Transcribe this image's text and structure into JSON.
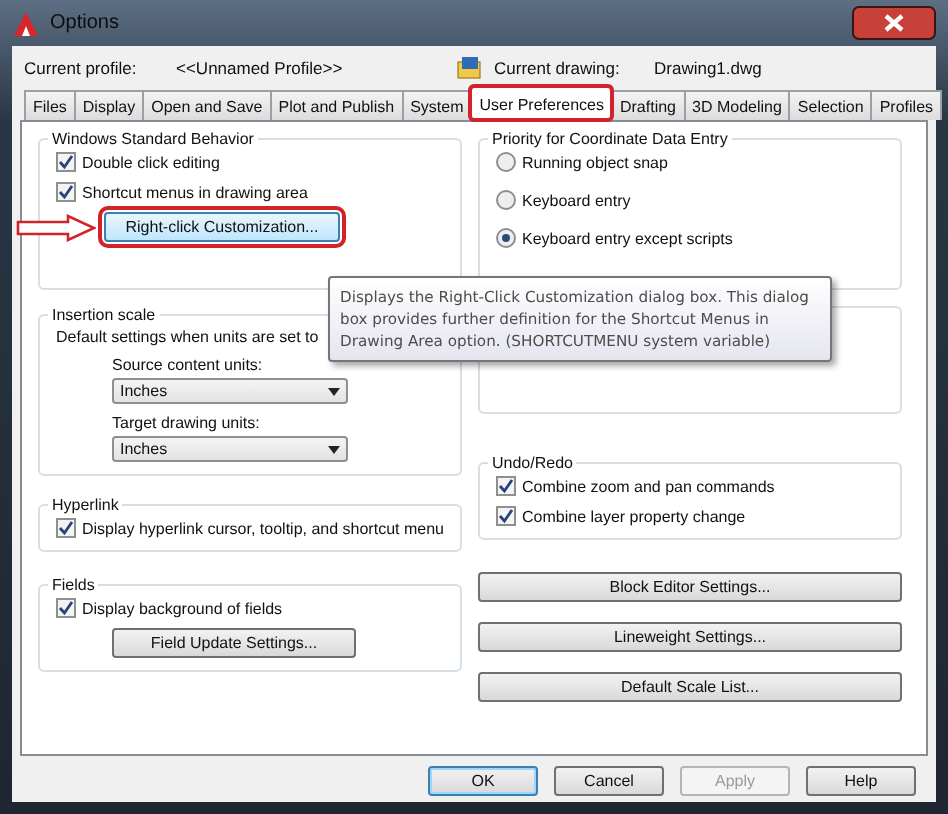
{
  "window": {
    "title": "Options"
  },
  "profile": {
    "label": "Current profile:",
    "value": "<<Unnamed Profile>>"
  },
  "drawing": {
    "label": "Current drawing:",
    "value": "Drawing1.dwg"
  },
  "tabs": [
    {
      "label": "Files",
      "selected": false,
      "highlighted": false
    },
    {
      "label": "Display",
      "selected": false,
      "highlighted": false
    },
    {
      "label": "Open and Save",
      "selected": false,
      "highlighted": false
    },
    {
      "label": "Plot and Publish",
      "selected": false,
      "highlighted": false
    },
    {
      "label": "System",
      "selected": false,
      "highlighted": false
    },
    {
      "label": "User Preferences",
      "selected": true,
      "highlighted": true
    },
    {
      "label": "Drafting",
      "selected": false,
      "highlighted": false
    },
    {
      "label": "3D Modeling",
      "selected": false,
      "highlighted": false
    },
    {
      "label": "Selection",
      "selected": false,
      "highlighted": false
    },
    {
      "label": "Profiles",
      "selected": false,
      "highlighted": false
    }
  ],
  "left_column": [
    {
      "kind": "group",
      "title": "Windows Standard Behavior",
      "items": [
        {
          "kind": "checkbox",
          "label": "Double click editing",
          "checked": true
        },
        {
          "kind": "checkbox",
          "label": "Shortcut menus in drawing area",
          "checked": true
        },
        {
          "kind": "button",
          "label": "Right-click Customization...",
          "highlighted": true,
          "arrow": true
        }
      ]
    },
    {
      "kind": "group",
      "title": "Insertion scale",
      "items": [
        {
          "kind": "text",
          "label": "Default settings when units are set to"
        },
        {
          "kind": "select",
          "label": "Source content units:",
          "value": "Inches"
        },
        {
          "kind": "select",
          "label": "Target drawing units:",
          "value": "Inches"
        }
      ]
    },
    {
      "kind": "group",
      "title": "Hyperlink",
      "items": [
        {
          "kind": "checkbox",
          "label": "Display hyperlink cursor, tooltip, and shortcut menu",
          "checked": true
        }
      ]
    },
    {
      "kind": "group",
      "title": "Fields",
      "items": [
        {
          "kind": "checkbox",
          "label": "Display background of fields",
          "checked": true
        },
        {
          "kind": "button",
          "label": "Field Update Settings...",
          "highlighted": false,
          "arrow": false
        }
      ]
    }
  ],
  "right_column": [
    {
      "kind": "group",
      "title": "Priority for Coordinate Data Entry",
      "items": [
        {
          "kind": "radio",
          "label": "Running object snap",
          "selected": false
        },
        {
          "kind": "radio",
          "label": "Keyboard entry",
          "selected": false
        },
        {
          "kind": "radio",
          "label": "Keyboard entry except scripts",
          "selected": true
        }
      ]
    },
    {
      "kind": "group"
    },
    {
      "kind": "group",
      "title": "Undo/Redo",
      "items": [
        {
          "kind": "checkbox",
          "label": "Combine zoom and pan commands",
          "checked": true
        },
        {
          "kind": "checkbox",
          "label": "Combine layer property change",
          "checked": true
        }
      ]
    },
    {
      "kind": "button",
      "label": "Block Editor Settings..."
    },
    {
      "kind": "button",
      "label": "Lineweight Settings..."
    },
    {
      "kind": "button",
      "label": "Default Scale List..."
    }
  ],
  "tooltip": {
    "text": "Displays the Right-Click Customization dialog box. This dialog box provides further definition for the Shortcut Menus in Drawing Area option. (SHORTCUTMENU system variable)"
  },
  "footer_buttons": [
    {
      "label": "OK",
      "default": true,
      "disabled": false
    },
    {
      "label": "Cancel",
      "default": false,
      "disabled": false
    },
    {
      "label": "Apply",
      "default": false,
      "disabled": true
    },
    {
      "label": "Help",
      "default": false,
      "disabled": false
    }
  ]
}
